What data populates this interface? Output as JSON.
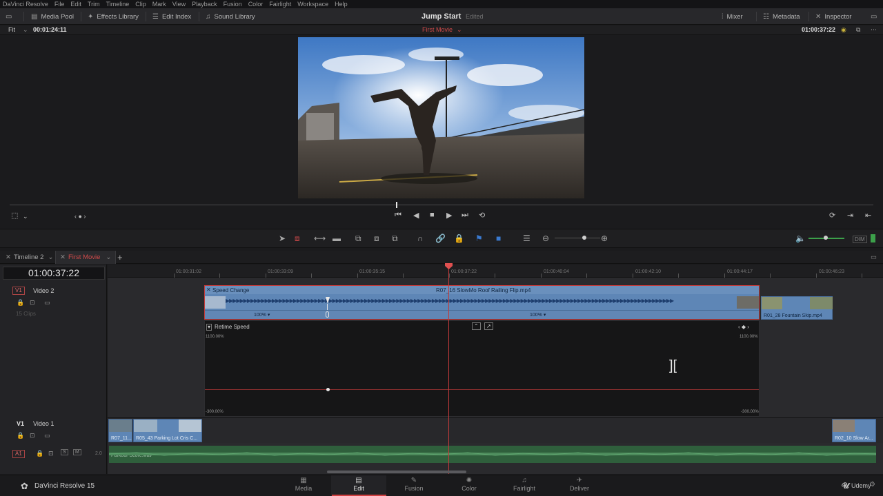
{
  "menu": [
    "DaVinci Resolve",
    "File",
    "Edit",
    "Trim",
    "Timeline",
    "Clip",
    "Mark",
    "View",
    "Playback",
    "Fusion",
    "Color",
    "Fairlight",
    "Workspace",
    "Help"
  ],
  "toolbar": {
    "media_pool": "Media Pool",
    "effects_library": "Effects Library",
    "edit_index": "Edit Index",
    "sound_library": "Sound Library",
    "project_title": "Jump Start",
    "project_status": "Edited",
    "mixer": "Mixer",
    "metadata": "Metadata",
    "inspector": "Inspector"
  },
  "viewer": {
    "zoom": "Fit",
    "source_timecode": "00:01:24:11",
    "timeline_name": "First Movie",
    "record_timecode": "01:00:37:22"
  },
  "timeline_tabs": [
    {
      "label": "Timeline 2",
      "active": false
    },
    {
      "label": "First Movie",
      "active": true
    }
  ],
  "timeline": {
    "current_timecode": "01:00:37:22",
    "ruler_ticks": [
      "01:00:31:02",
      "01:00:33:09",
      "01:00:35:15",
      "01:00:37:22",
      "01:00:40:04",
      "01:00:42:10",
      "01:00:44:17",
      "01:00:46:23"
    ]
  },
  "tracks": {
    "video2": {
      "badge": "V1",
      "name": "Video 2",
      "clip_count": "15 Clips"
    },
    "video1": {
      "badge": "V1",
      "name": "Video 1"
    },
    "audio1": {
      "badge": "A1",
      "level": "2.0"
    }
  },
  "clips": {
    "speed_change_label": "Speed Change",
    "main_clip": "R07_16 SlowMo Roof Railing Flip.mp4",
    "speed_left": "100%",
    "speed_right": "100%",
    "fountain_clip": "R01_28 Fountain Skip.mp4",
    "retime_title": "Retime Speed",
    "retime_max_left": "1100.00%",
    "retime_max_right": "1100.00%",
    "retime_min_left": "-300.00%",
    "retime_min_right": "-300.00%",
    "v1_clips": [
      "R07_11...",
      "R05_43 Parking Lot Cris C...",
      "R02_10 Slow Ar..."
    ],
    "audio_clip": "Parkour Score.wav"
  },
  "pages": [
    {
      "label": "Media",
      "icon": "media-icon"
    },
    {
      "label": "Edit",
      "icon": "edit-icon"
    },
    {
      "label": "Fusion",
      "icon": "fusion-icon"
    },
    {
      "label": "Color",
      "icon": "color-icon"
    },
    {
      "label": "Fairlight",
      "icon": "fairlight-icon"
    },
    {
      "label": "Deliver",
      "icon": "deliver-icon"
    }
  ],
  "active_page": "Edit",
  "app_name": "DaVinci Resolve 15",
  "watermark": "Udemy",
  "colors": {
    "accent_red": "#d04040",
    "clip_blue": "#5e86b6",
    "audio_green": "#2f5f3c",
    "background": "#1b1b1d"
  }
}
